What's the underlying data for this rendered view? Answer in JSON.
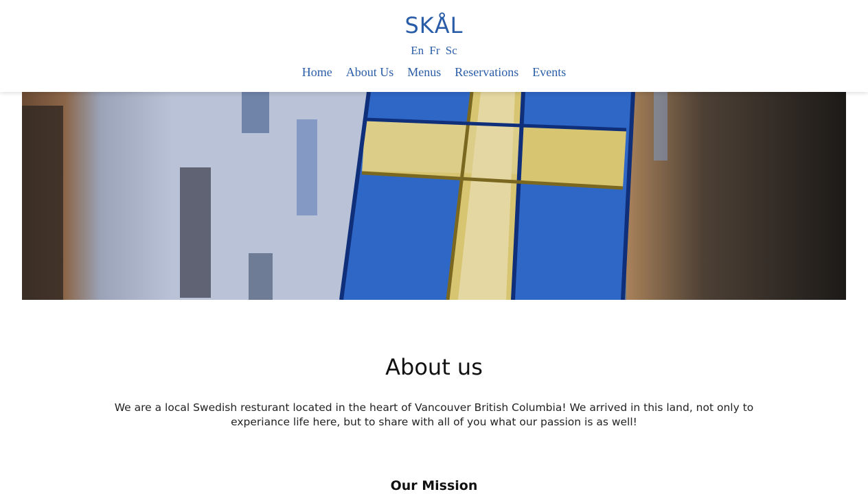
{
  "header": {
    "logo": "SKÅL",
    "languages": [
      "En",
      "Fr",
      "Sc"
    ],
    "nav": [
      "Home",
      "About Us",
      "Menus",
      "Reservations",
      "Events"
    ]
  },
  "hero": {
    "image_alt": "Swedish flag hanging in a street"
  },
  "about": {
    "title": "About us",
    "text": "We are a local Swedish resturant located in the heart of Vancouver British Columbia! We arrived in this land, not only to experiance life here, but to share with all of you what our passion is as well!"
  },
  "mission": {
    "title": "Our Mission"
  },
  "colors": {
    "brand": "#2a5da8",
    "flag_blue": "#1f5fbf",
    "flag_yellow": "#d9c26a"
  }
}
